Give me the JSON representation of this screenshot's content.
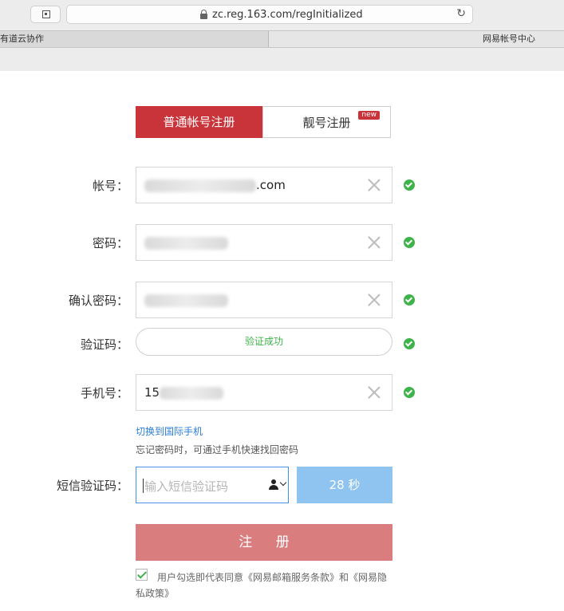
{
  "browser": {
    "url": "zc.reg.163.com/regInitialized",
    "tabs": [
      "有道云协作",
      "网易帐号中心"
    ]
  },
  "register": {
    "mode_tabs": [
      {
        "label": "普通帐号注册",
        "active": true
      },
      {
        "label": "靓号注册",
        "active": false,
        "badge": "new"
      }
    ],
    "account": {
      "label": "帐号：",
      "value_suffix": ".com"
    },
    "password": {
      "label": "密码："
    },
    "confirm_password": {
      "label": "确认密码："
    },
    "captcha": {
      "label": "验证码：",
      "status": "验证成功"
    },
    "phone": {
      "label": "手机号：",
      "value_prefix": "15"
    },
    "intl_link": "切换到国际手机",
    "hint": "忘记密码时，可通过手机快速找回密码",
    "sms": {
      "label": "短信验证码：",
      "placeholder": "输入短信验证码",
      "countdown": "28 秒"
    },
    "submit_label": "注 册",
    "agreement": {
      "checked": true,
      "text": "用户勾选即代表同意《网易邮箱服务条款》和《网易隐私政策》"
    }
  },
  "colors": {
    "brand_red": "#c9343b",
    "success_green": "#3eb34a",
    "link_blue": "#2a7ed6",
    "countdown_blue": "#8fc4f1"
  }
}
